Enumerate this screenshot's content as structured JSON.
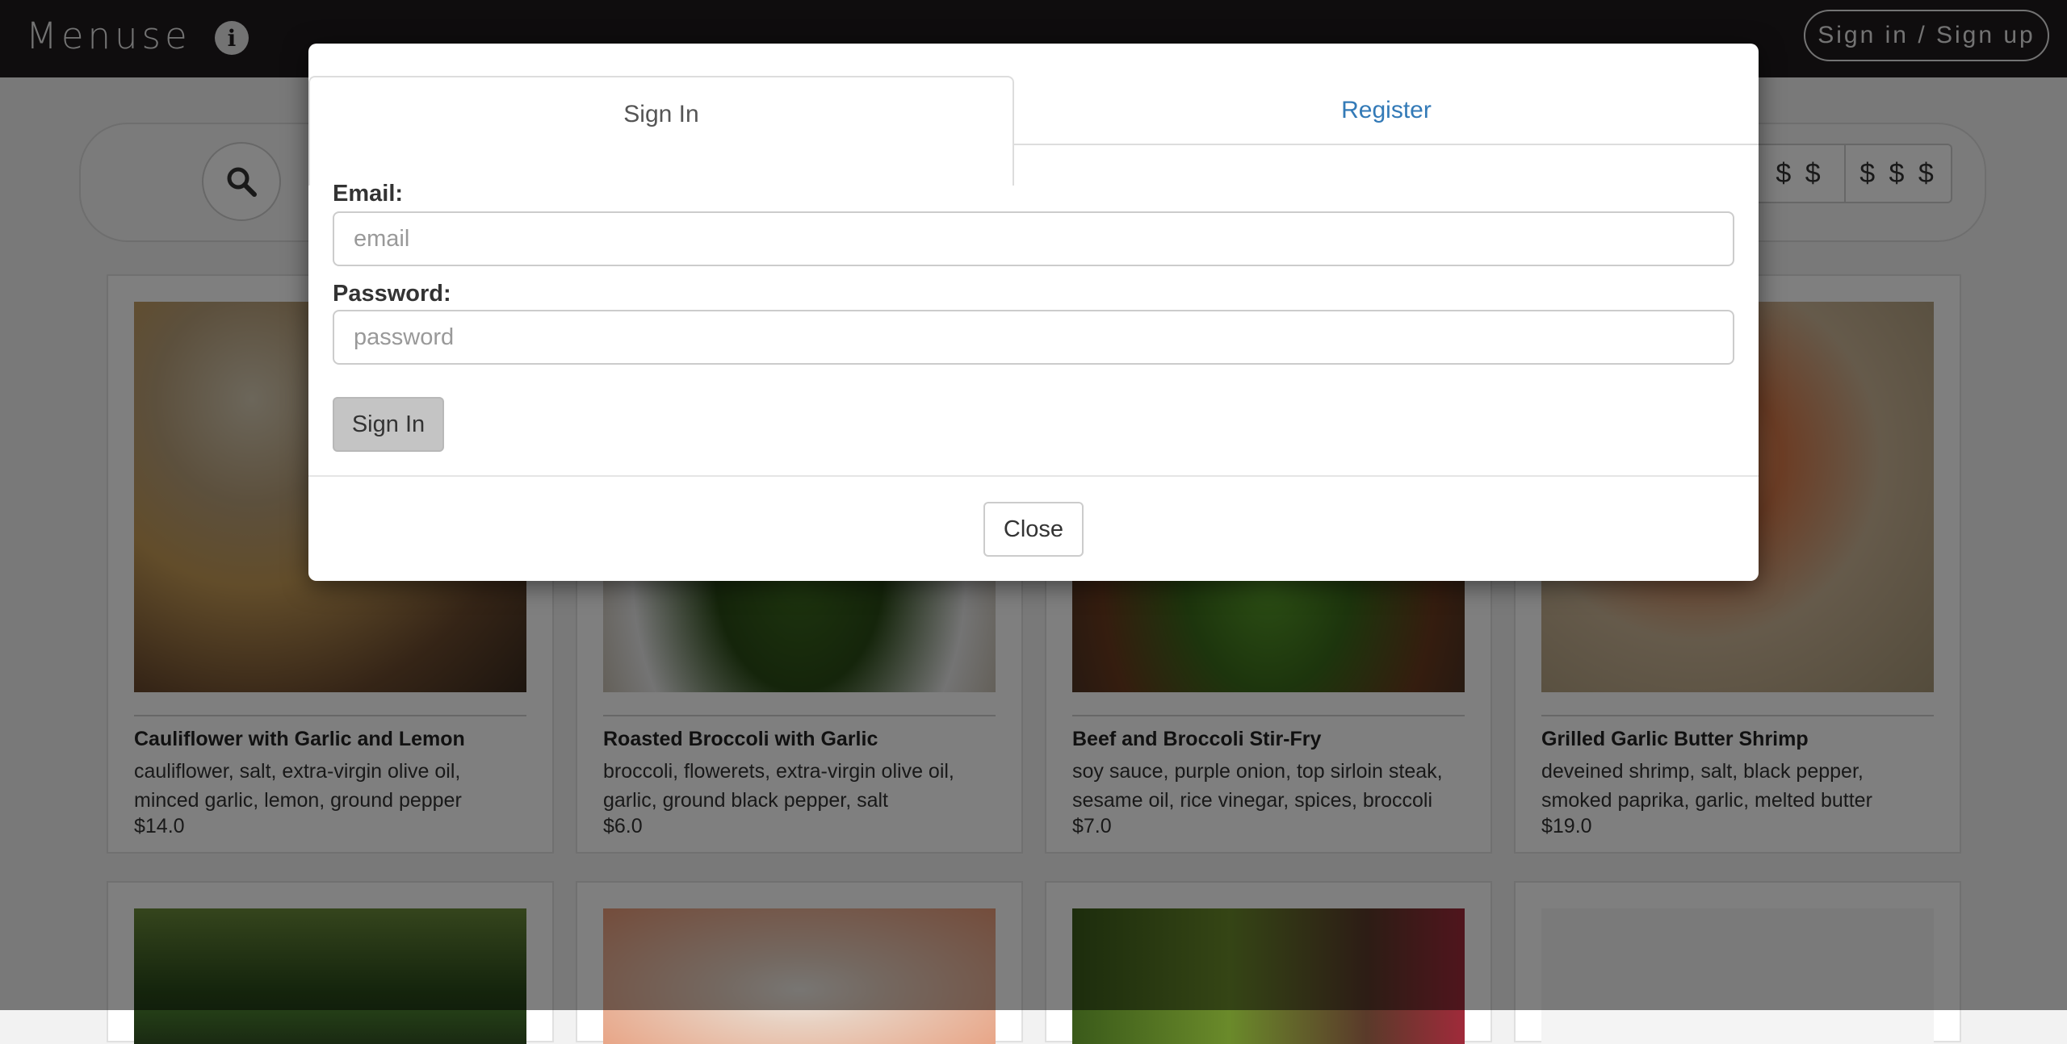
{
  "navbar": {
    "brand": "Menuse",
    "info_icon": "info-icon",
    "signin_label": "Sign in / Sign up"
  },
  "searchbar": {
    "search_icon": "search-icon",
    "price_filters": [
      "$",
      "$ $",
      "$ $ $"
    ]
  },
  "cards": [
    {
      "title": "Cauliflower with Garlic and Lemon",
      "ingredients": "cauliflower, salt, extra-virgin olive oil, minced garlic, lemon, ground pepper",
      "price": "$14.0"
    },
    {
      "title": "Roasted Broccoli with Garlic",
      "ingredients": "broccoli, flowerets, extra-virgin olive oil, garlic, ground black pepper, salt",
      "price": "$6.0"
    },
    {
      "title": "Beef and Broccoli Stir-Fry",
      "ingredients": "soy sauce, purple onion, top sirloin steak, sesame oil, rice vinegar, spices, broccoli",
      "price": "$7.0"
    },
    {
      "title": "Grilled Garlic Butter Shrimp",
      "ingredients": "deveined shrimp, salt, black pepper, smoked paprika, garlic, melted butter",
      "price": "$19.0"
    }
  ],
  "modal": {
    "tabs": {
      "signin": "Sign In",
      "register": "Register"
    },
    "email_label": "Email:",
    "email_placeholder": "email",
    "password_label": "Password:",
    "password_placeholder": "password",
    "submit_label": "Sign In",
    "close_label": "Close"
  },
  "colors": {
    "navbar_bg": "#1f1a1d",
    "link_blue": "#337ab7",
    "submit_bg": "#c4c4c4"
  }
}
